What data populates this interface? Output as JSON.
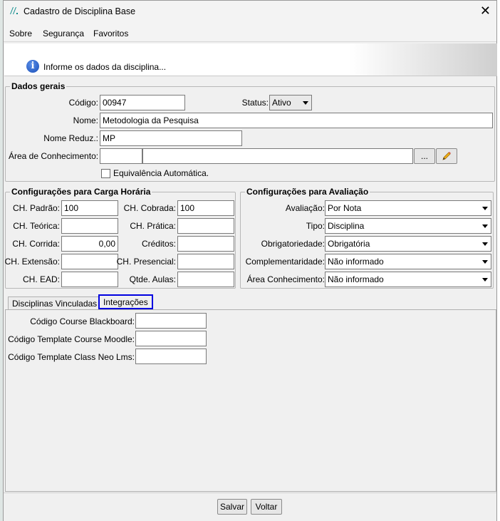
{
  "window": {
    "title": "Cadastro de Disciplina Base",
    "close_glyph": "✕",
    "logo_glyph": "/\\\\."
  },
  "menu": {
    "items": [
      "Sobre",
      "Segurança",
      "Favoritos"
    ]
  },
  "banner": {
    "icon_glyph": "i",
    "message": "Informe os dados da disciplina..."
  },
  "dados_gerais": {
    "legend": "Dados gerais",
    "codigo_label": "Código:",
    "codigo_value": "00947",
    "status_label": "Status:",
    "status_value": "Ativo",
    "nome_label": "Nome:",
    "nome_value": "Metodologia da Pesquisa",
    "nome_reduz_label": "Nome Reduz.:",
    "nome_reduz_value": "MP",
    "area_label": "Área de Conhecimento:",
    "area_code_value": "",
    "area_desc_value": "",
    "browse_label": "...",
    "equivalencia_label": "Equivalência Automática.",
    "equivalencia_checked": false
  },
  "carga_horaria": {
    "legend": "Configurações para Carga Horária",
    "ch_padrao_label": "CH. Padrão:",
    "ch_padrao_value": "100",
    "ch_cobrada_label": "CH. Cobrada:",
    "ch_cobrada_value": "100",
    "ch_teorica_label": "CH. Teórica:",
    "ch_teorica_value": "",
    "ch_pratica_label": "CH. Prática:",
    "ch_pratica_value": "",
    "ch_corrida_label": "CH. Corrida:",
    "ch_corrida_value": "0,00",
    "creditos_label": "Créditos:",
    "creditos_value": "",
    "ch_extensao_label": "CH. Extensão:",
    "ch_extensao_value": "",
    "ch_presencial_label": "CH. Presencial:",
    "ch_presencial_value": "",
    "ch_ead_label": "CH. EAD:",
    "ch_ead_value": "",
    "qtde_aulas_label": "Qtde. Aulas:",
    "qtde_aulas_value": ""
  },
  "avaliacao": {
    "legend": "Configurações para Avaliação",
    "avaliacao_label": "Avaliação:",
    "avaliacao_value": "Por Nota",
    "tipo_label": "Tipo:",
    "tipo_value": "Disciplina",
    "obrigatoriedade_label": "Obrigatoriedade:",
    "obrigatoriedade_value": "Obrigatória",
    "complementaridade_label": "Complementaridade:",
    "complementaridade_value": "Não informado",
    "area_label": "Área Conhecimento:",
    "area_value": "Não informado"
  },
  "tabs": {
    "vinculadas_label": "Disciplinas Vinculadas",
    "integracoes_label": "Integrações",
    "active": "Integrações"
  },
  "integracoes": {
    "blackboard_label": "Código Course Blackboard:",
    "blackboard_value": "",
    "moodle_label": "Código Template Course Moodle:",
    "moodle_value": "",
    "neo_label": "Código Template Class Neo Lms:",
    "neo_value": ""
  },
  "footer": {
    "salvar_label": "Salvar",
    "voltar_label": "Voltar"
  },
  "colors": {
    "active_tab_border": "#0000e0",
    "info_icon": "#1a4fb8",
    "logo": "#0c8a8a"
  }
}
